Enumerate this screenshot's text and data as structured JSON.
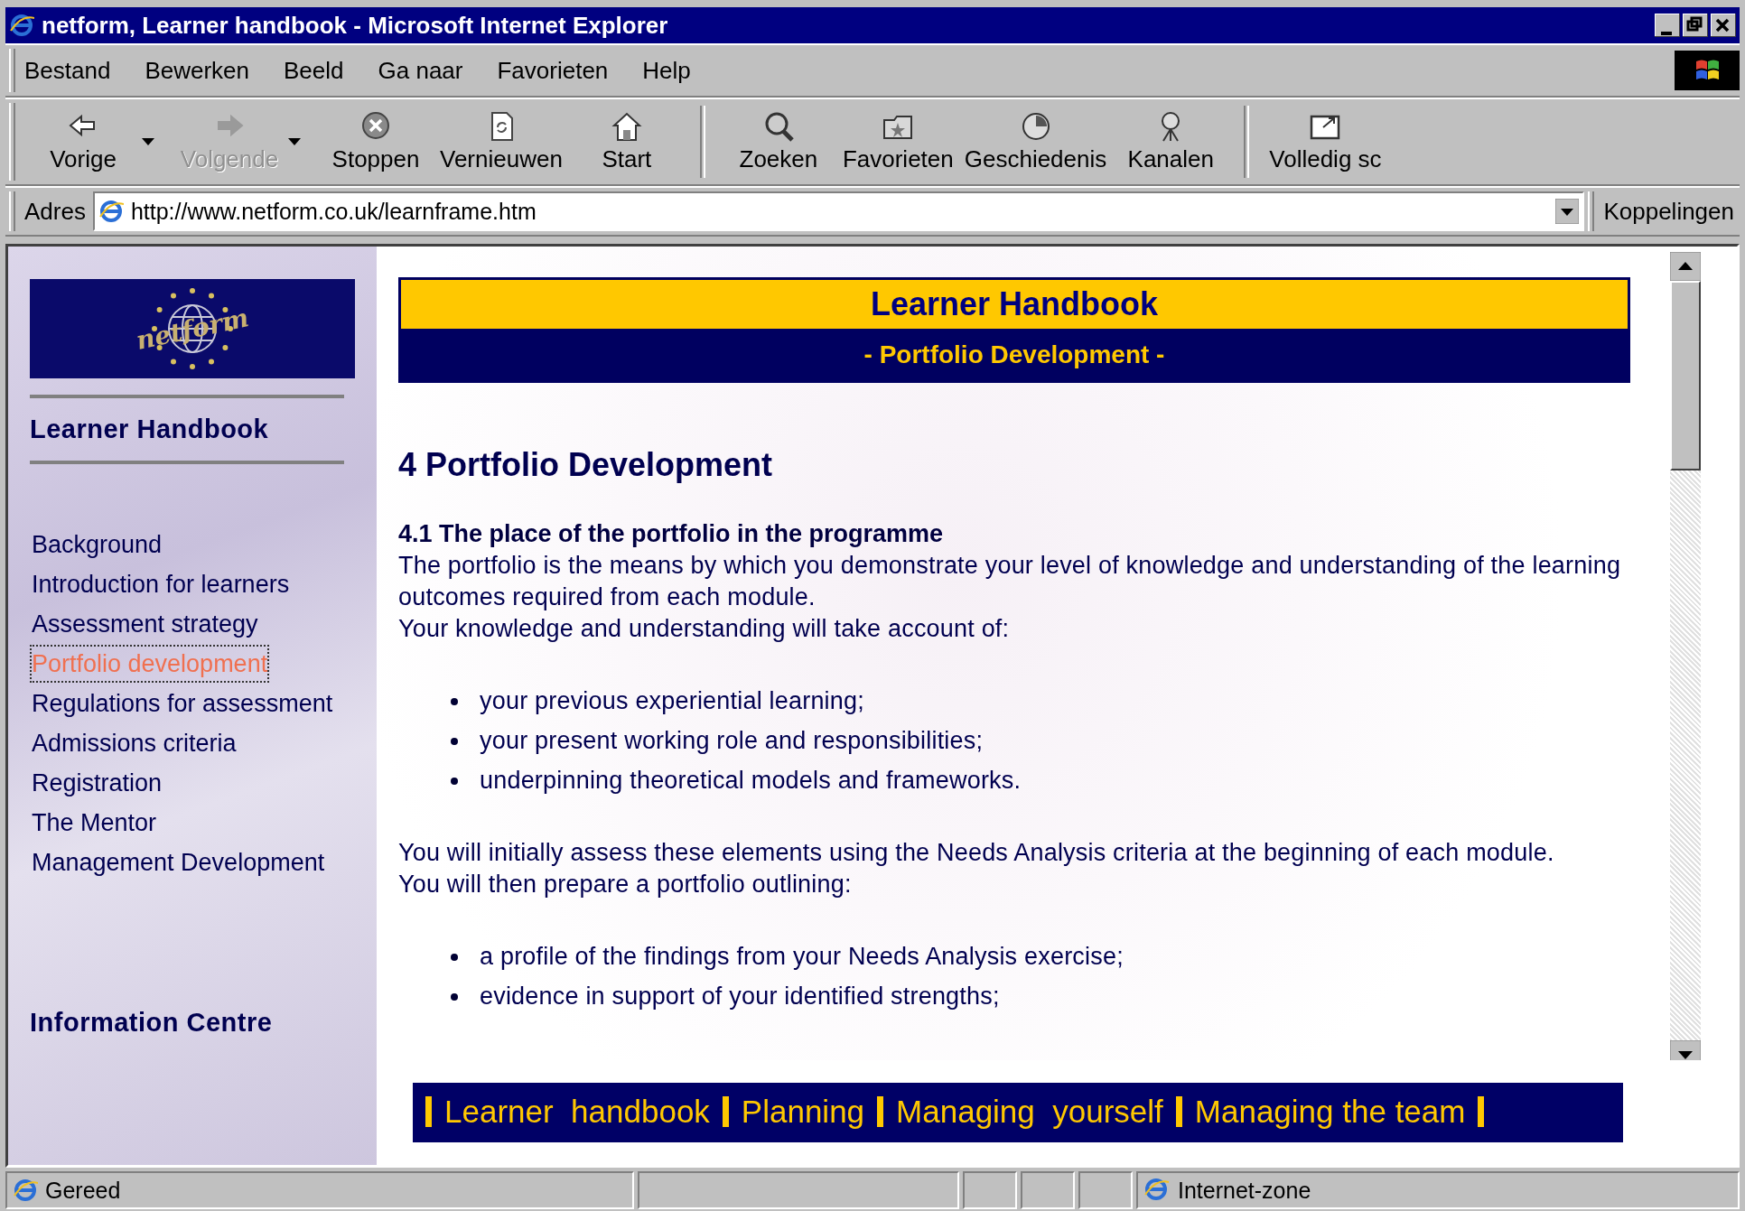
{
  "window": {
    "title": "netform, Learner handbook - Microsoft Internet Explorer"
  },
  "menu": [
    {
      "label": "Bestand"
    },
    {
      "label": "Bewerken"
    },
    {
      "label": "Beeld"
    },
    {
      "label": "Ga naar"
    },
    {
      "label": "Favorieten"
    },
    {
      "label": "Help"
    }
  ],
  "toolbar": [
    {
      "label": "Vorige",
      "kind": "back",
      "disabled": false,
      "dropdown": true
    },
    {
      "label": "Volgende",
      "kind": "forward",
      "disabled": true,
      "dropdown": true
    },
    {
      "label": "Stoppen",
      "kind": "stop",
      "disabled": false,
      "dropdown": false
    },
    {
      "label": "Vernieuwen",
      "kind": "refresh",
      "disabled": false,
      "dropdown": false
    },
    {
      "label": "Start",
      "kind": "home",
      "disabled": false,
      "dropdown": false
    },
    {
      "label": "Zoeken",
      "kind": "search",
      "disabled": false,
      "dropdown": false
    },
    {
      "label": "Favorieten",
      "kind": "favorites",
      "disabled": false,
      "dropdown": false
    },
    {
      "label": "Geschiedenis",
      "kind": "history",
      "disabled": false,
      "dropdown": false
    },
    {
      "label": "Kanalen",
      "kind": "channels",
      "disabled": false,
      "dropdown": false
    },
    {
      "label": "Volledig sc",
      "kind": "fullscreen",
      "disabled": false,
      "dropdown": false
    }
  ],
  "address_bar": {
    "label": "Adres",
    "value": "http://www.netform.co.uk/learnframe.htm",
    "links": "Koppelingen"
  },
  "sidebar": {
    "logo": "netform",
    "heading": "Learner Handbook",
    "items": [
      {
        "label": "Background",
        "selected": false
      },
      {
        "label": "Introduction for learners",
        "selected": false
      },
      {
        "label": "Assessment strategy",
        "selected": false
      },
      {
        "label": "Portfolio development",
        "selected": true
      },
      {
        "label": "Regulations for assessment",
        "selected": false
      },
      {
        "label": "Admissions criteria",
        "selected": false
      },
      {
        "label": "Registration",
        "selected": false
      },
      {
        "label": "The Mentor",
        "selected": false
      },
      {
        "label": "Management Development",
        "selected": false
      }
    ],
    "section": "Information Centre"
  },
  "banner": {
    "title": "Learner Handbook",
    "subtitle": "- Portfolio Development -"
  },
  "article": {
    "heading": "4 Portfolio Development",
    "blocks": [
      {
        "kind": "subheading",
        "text": "4.1 The place of the portfolio in the programme"
      },
      {
        "kind": "paragraph",
        "text": "The portfolio is the means by which you demonstrate your level of knowledge and understanding of the learning outcomes required from each module."
      },
      {
        "kind": "paragraph",
        "text": "Your knowledge and understanding will take account of:"
      },
      {
        "kind": "list",
        "items": [
          "your previous experiential learning;",
          "your present working role and responsibilities;",
          "underpinning theoretical models and frameworks."
        ]
      },
      {
        "kind": "paragraph",
        "text": "You will initially assess these elements using the Needs Analysis criteria at the beginning of each module."
      },
      {
        "kind": "paragraph",
        "text": "You will then prepare a portfolio outlining:"
      },
      {
        "kind": "list",
        "items": [
          "a profile of the findings from your Needs Analysis exercise;",
          "evidence in support of your identified strengths;"
        ]
      }
    ]
  },
  "bottom_nav": [
    {
      "label": "Learner  handbook"
    },
    {
      "label": "Planning"
    },
    {
      "label": "Managing  yourself"
    },
    {
      "label": "Managing the team"
    }
  ],
  "status_bar": {
    "text": "Gereed",
    "zone": "Internet-zone"
  }
}
